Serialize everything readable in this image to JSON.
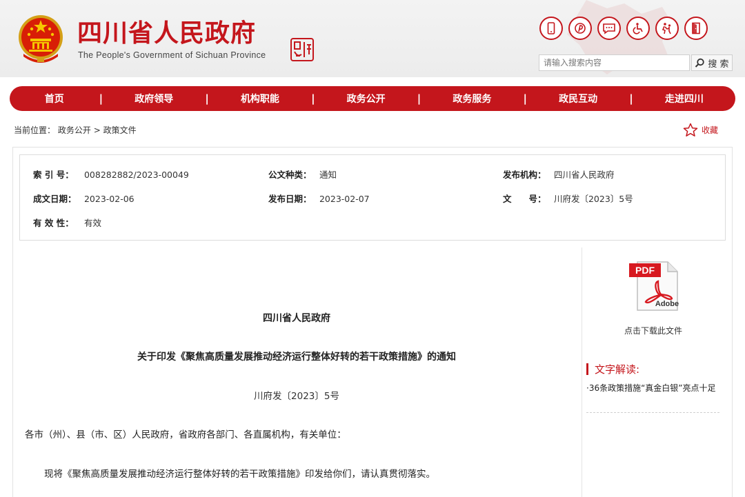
{
  "header": {
    "title": "四川省人民政府",
    "subtitle": "The People's Government of Sichuan Province",
    "seal_icon": "sichuan-seal-icon",
    "emblem_icon": "national-emblem-icon",
    "accent_color": "#c4161c",
    "top_icons": [
      {
        "name": "mobile-phone-icon"
      },
      {
        "name": "weibo-icon"
      },
      {
        "name": "message-icon"
      },
      {
        "name": "wheelchair-accessibility-icon"
      },
      {
        "name": "elderly-care-icon"
      },
      {
        "name": "exit-door-icon"
      }
    ],
    "search": {
      "placeholder": "请输入搜索内容",
      "button_label": "搜 索"
    }
  },
  "nav": {
    "items": [
      {
        "label": "首页"
      },
      {
        "label": "政府领导"
      },
      {
        "label": "机构职能"
      },
      {
        "label": "政务公开"
      },
      {
        "label": "政务服务"
      },
      {
        "label": "政民互动"
      },
      {
        "label": "走进四川"
      }
    ],
    "separator": "|"
  },
  "breadcrumb": {
    "prefix": "当前位置：",
    "items": [
      "政务公开",
      "政策文件"
    ],
    "separator": ">",
    "favorite_label": "收藏"
  },
  "metadata": {
    "index_no": {
      "label": "索 引 号：",
      "value": "008282882/2023-00049"
    },
    "doc_type": {
      "label": "公文种类：",
      "value": "通知"
    },
    "issuer": {
      "label": "发布机构：",
      "value": "四川省人民政府"
    },
    "created": {
      "label": "成文日期：",
      "value": "2023-02-06"
    },
    "published": {
      "label": "发布日期：",
      "value": "2023-02-07"
    },
    "doc_no": {
      "label": "文　　号：",
      "value": "川府发〔2023〕5号"
    },
    "validity": {
      "label": "有 效 性：",
      "value": "有效"
    }
  },
  "document": {
    "issuer": "四川省人民政府",
    "title": "关于印发《聚焦高质量发展推动经济运行整体好转的若干政策措施》的通知",
    "number": "川府发〔2023〕5号",
    "salutation": "各市（州）、县（市、区）人民政府，省政府各部门、各直属机构，有关单位：",
    "body": "现将《聚焦高质量发展推动经济运行整体好转的若干政策措施》印发给你们，请认真贯彻落实。"
  },
  "sidebar": {
    "pdf_icon_label": "PDF",
    "pdf_brand_label": "Adobe",
    "download_label": "点击下载此文件",
    "interpretation_title": "文字解读:",
    "interpretation_link": "·36条政策措施“真金白银”亮点十足"
  }
}
